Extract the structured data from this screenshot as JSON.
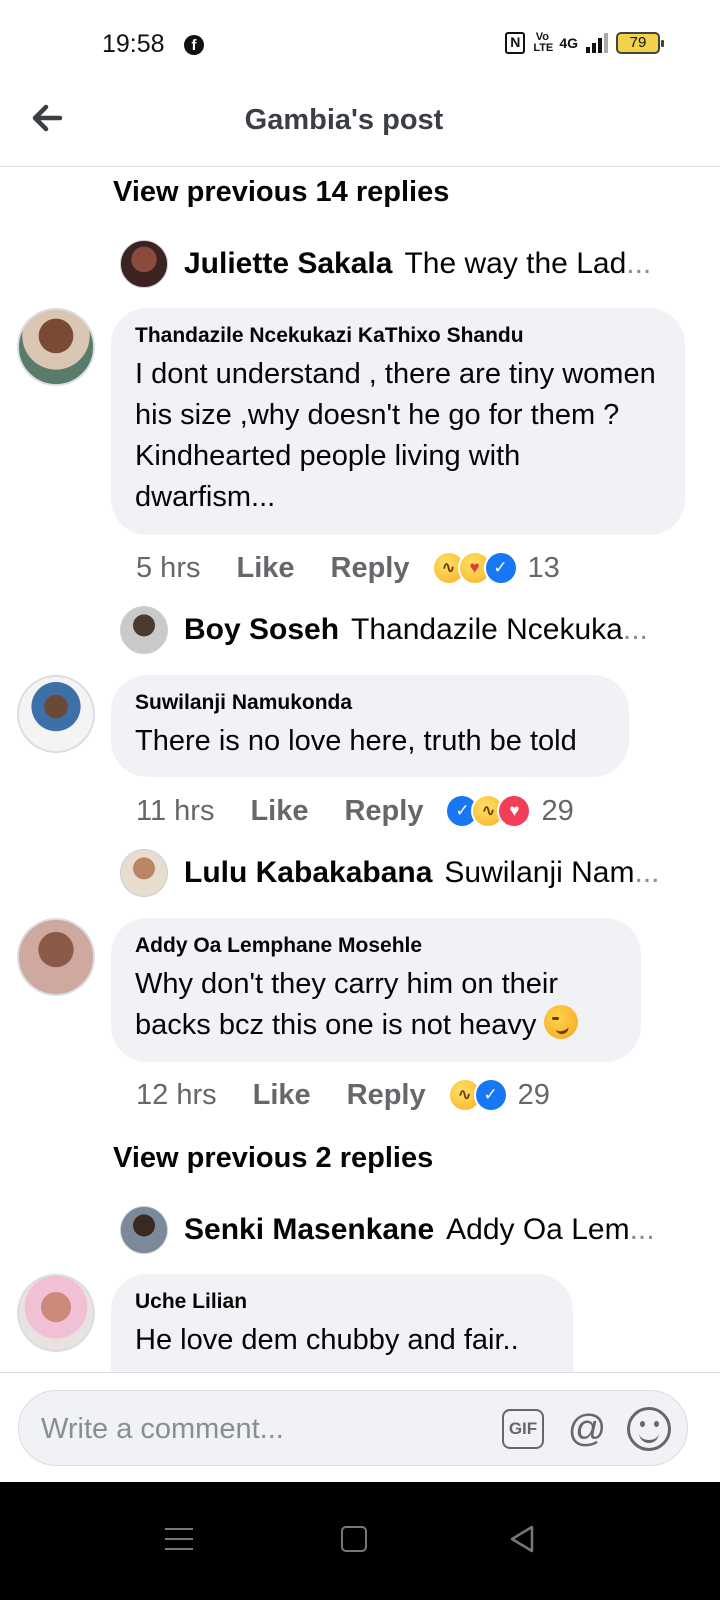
{
  "status_bar": {
    "time": "19:58",
    "nfc": "N",
    "volte": "Vo LTE",
    "network": "4G",
    "battery": "79"
  },
  "header": {
    "title": "Gambia's post"
  },
  "thread": {
    "view_previous_1": "View previous 14 replies",
    "reply_1": {
      "name": "Juliette Sakala",
      "snippet": "The way the Lad",
      "ellipsis": "..."
    },
    "comment_1": {
      "name": "Thandazile Ncekukazi KaThixo Shandu",
      "text": "I dont understand , there are tiny women his size ,why doesn't he go for them ? Kindhearted people living with dwarfism...",
      "time": "5 hrs",
      "like": "Like",
      "reply": "Reply",
      "count": "13",
      "reactions": [
        "haha",
        "care",
        "like"
      ]
    },
    "reply_2": {
      "name": "Boy Soseh",
      "snippet": "Thandazile Ncekuka",
      "ellipsis": "..."
    },
    "comment_2": {
      "name": "Suwilanji Namukonda",
      "text": "There is no love here, truth be told",
      "time": "11 hrs",
      "like": "Like",
      "reply": "Reply",
      "count": "29",
      "reactions": [
        "like",
        "haha",
        "love"
      ]
    },
    "reply_3": {
      "name": "Lulu Kabakabana",
      "snippet": "Suwilanji Nam",
      "ellipsis": "..."
    },
    "comment_3": {
      "name": "Addy Oa Lemphane Mosehle",
      "text_line1": "Why don't they carry him on their",
      "text_line2": "backs bcz this one is not heavy",
      "time": "12 hrs",
      "like": "Like",
      "reply": "Reply",
      "count": "29",
      "reactions": [
        "haha",
        "like"
      ]
    },
    "view_previous_2": "View previous 2 replies",
    "reply_4": {
      "name": "Senki Masenkane",
      "snippet": "Addy Oa Lem",
      "ellipsis": "..."
    },
    "comment_4": {
      "name": "Uche Lilian",
      "text": "He love dem chubby and fair.."
    }
  },
  "composer": {
    "placeholder": "Write a comment...",
    "gif_label": "GIF",
    "mention_label": "@"
  },
  "colors": {
    "accent": "#1877f2",
    "bubble": "#f0f2f5",
    "muted": "#65676b",
    "love": "#f33e58"
  }
}
